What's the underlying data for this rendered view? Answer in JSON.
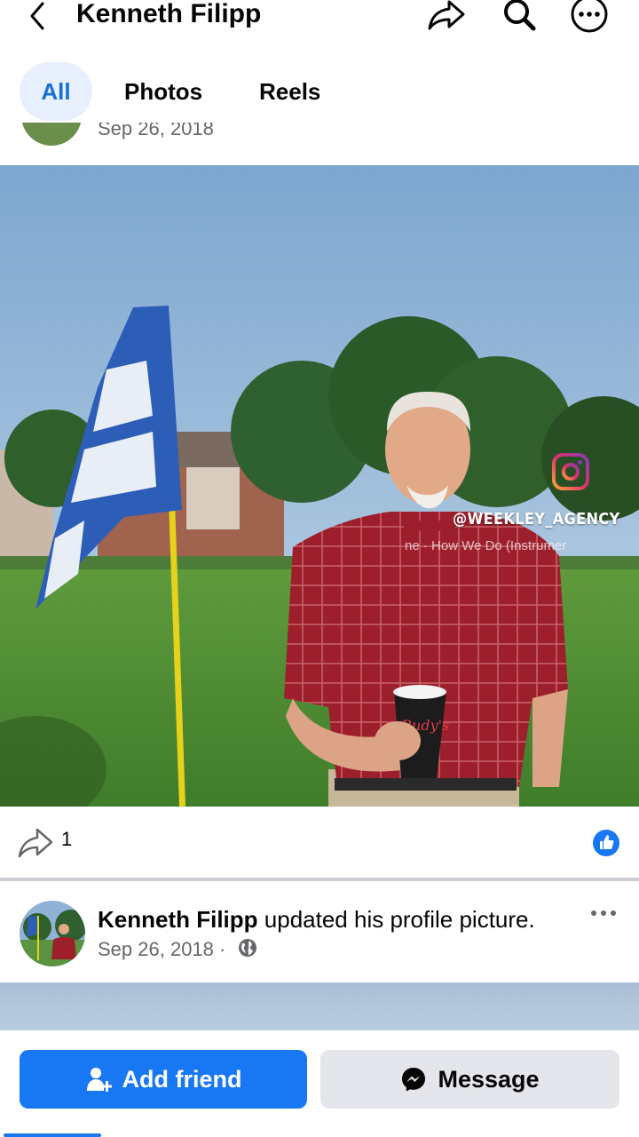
{
  "header": {
    "title": "Kenneth Filipp",
    "icons": [
      "chevron-left-icon",
      "share-icon",
      "search-icon",
      "more-icon"
    ]
  },
  "filters": {
    "tabs": [
      {
        "label": "All",
        "selected": true
      },
      {
        "label": "Photos",
        "selected": false
      },
      {
        "label": "Reels",
        "selected": false
      }
    ]
  },
  "previous_post": {
    "date": "Sep 26, 2018"
  },
  "photo": {
    "watermark_handle": "@WEEKLEY_AGENCY",
    "music_text": "ne · How We Do (Instrumer",
    "cup_text": "Rudy's"
  },
  "actions": {
    "share_count": "1"
  },
  "post": {
    "author": "Kenneth Filipp",
    "action_text": " updated his profile picture.",
    "date": "Sep 26, 2018",
    "separator": "·"
  },
  "bottom_bar": {
    "add_friend_label": "Add friend",
    "message_label": "Message"
  },
  "colors": {
    "accent": "#1877f2",
    "chip_bg": "#e7f0fc",
    "secondary_text": "#65676b",
    "button_gray": "#e4e6eb"
  }
}
